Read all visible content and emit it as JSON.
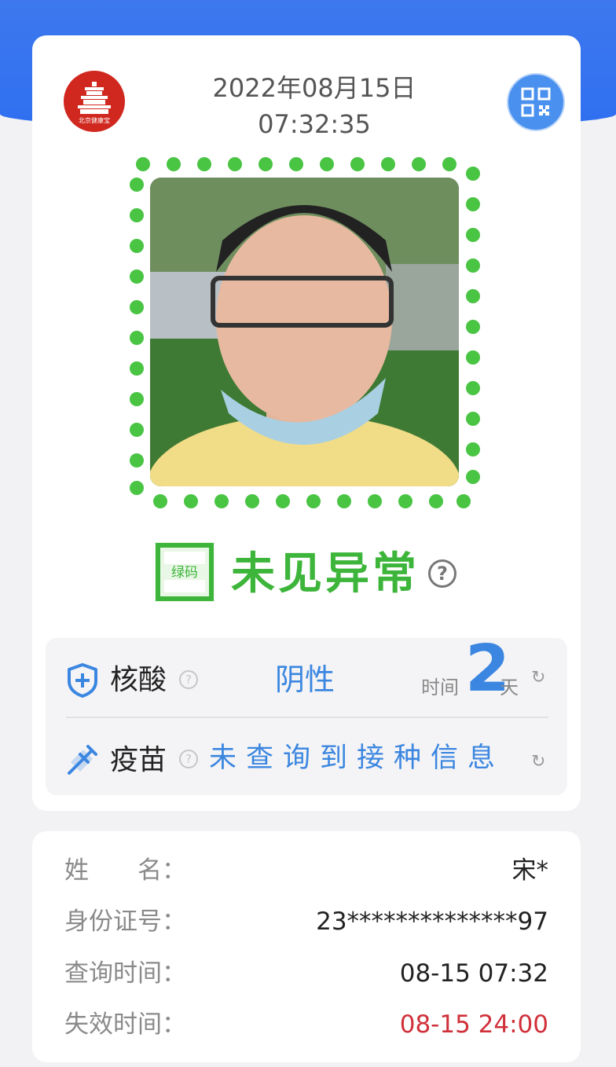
{
  "header": {
    "date": "2022年08月15日",
    "time": "07:32:35",
    "logo_text": "北京健康宝"
  },
  "status": {
    "icon_label": "绿码",
    "text": "未见异常",
    "help": "?"
  },
  "nucleic": {
    "label": "核酸",
    "help": "?",
    "result": "阴性",
    "time_label": "时间",
    "days": "2",
    "day_unit": "天",
    "refresh": "↻"
  },
  "vaccine": {
    "label": "疫苗",
    "help": "?",
    "result": "未查询到接种信息",
    "refresh": "↻"
  },
  "info": {
    "name_label": "姓　　名：",
    "name_value": "宋*",
    "id_label": "身份证号：",
    "id_value": "23**************97",
    "query_label": "查询时间：",
    "query_value": "08-15 07:32",
    "expire_label": "失效时间：",
    "expire_value": "08-15 24:00"
  },
  "colors": {
    "brand_blue": "#2f6ff0",
    "green": "#3db53a",
    "accent_blue": "#3b86e0",
    "expire_red": "#d0303a"
  },
  "icons": [
    "qr-code-icon",
    "shield-plus-icon",
    "syringe-icon",
    "refresh-icon",
    "help-icon"
  ]
}
